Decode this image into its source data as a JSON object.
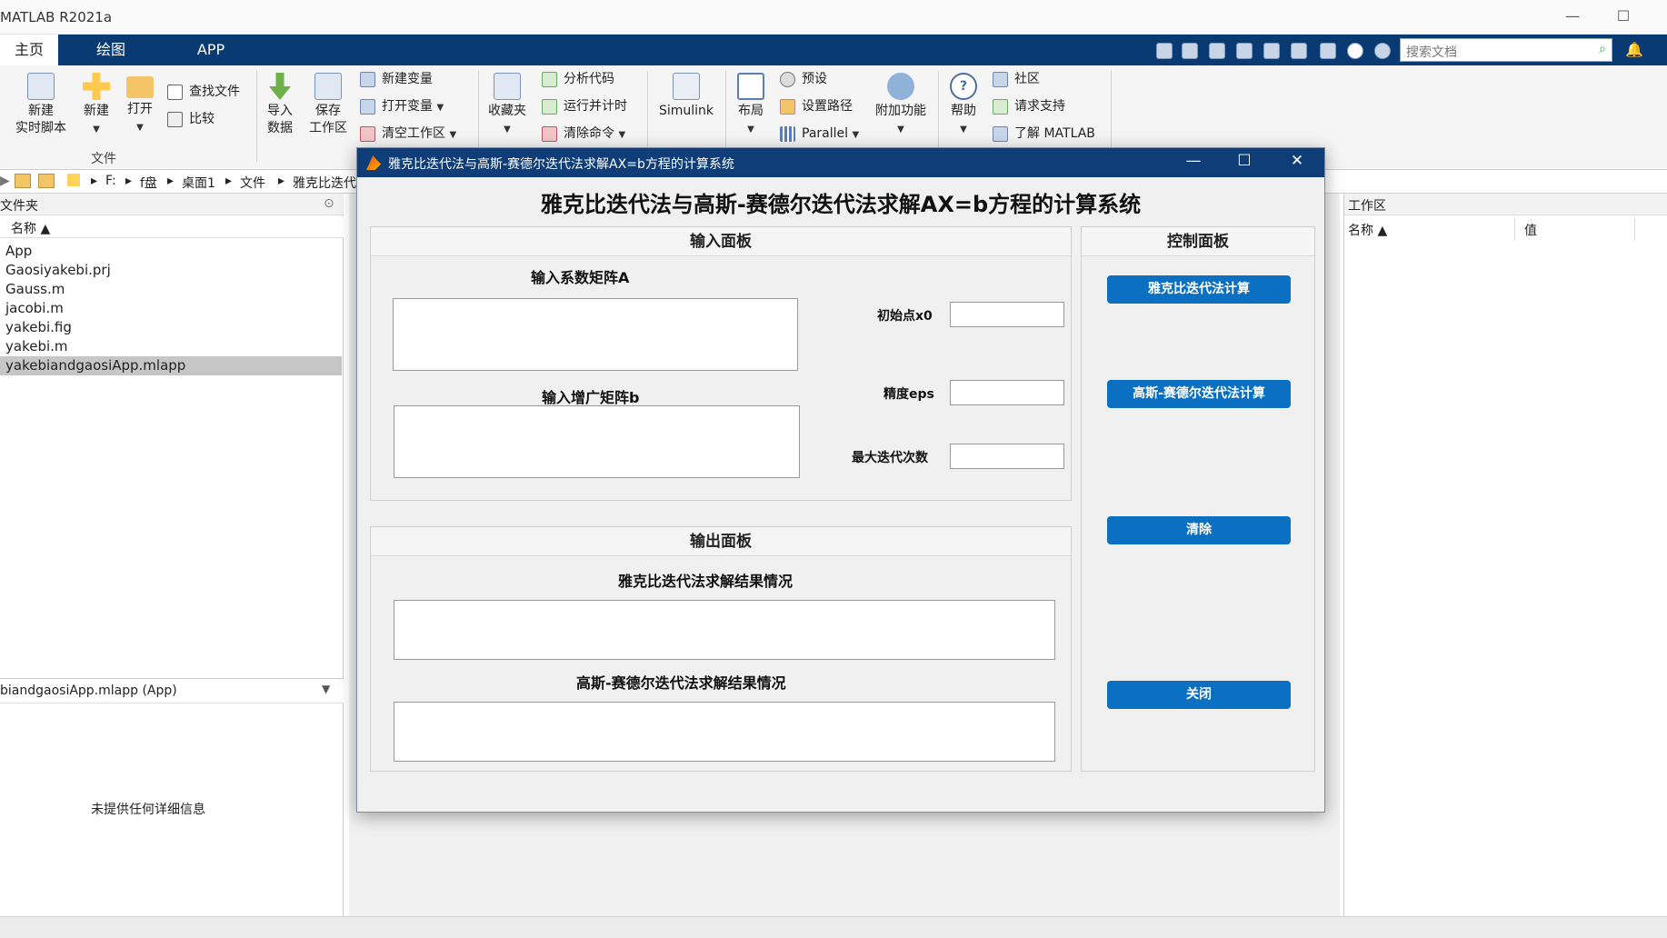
{
  "window": {
    "title": "MATLAB R2021a"
  },
  "ribbon_tabs": [
    "主页",
    "绘图",
    "APP"
  ],
  "search": {
    "placeholder": "搜索文档"
  },
  "ribbon": {
    "new_live_script": "新建\n实时脚本",
    "new": "新建",
    "open": "打开",
    "find_files": "查找文件",
    "compare": "比较",
    "file_group": "文件",
    "import_data": "导入\n数据",
    "save_workspace": "保存\n工作区",
    "new_variable": "新建变量",
    "open_variable": "打开变量",
    "clear_workspace": "清空工作区",
    "favorites": "收藏夹",
    "analyze_code": "分析代码",
    "run_and_time": "运行并计时",
    "clear_commands": "清除命令",
    "simulink": "Simulink",
    "layout": "布局",
    "preferences": "预设",
    "set_path": "设置路径",
    "parallel": "Parallel",
    "addons": "附加功能",
    "help": "帮助",
    "community": "社区",
    "request_support": "请求支持",
    "learn_matlab": "了解 MATLAB"
  },
  "address": [
    "F:",
    "f盘",
    "桌面1",
    "文件",
    "雅克比迭代"
  ],
  "files_panel": {
    "title": "文件夹",
    "column": "名称 ▲",
    "items": [
      "App",
      "Gaosiyakebi.prj",
      "Gauss.m",
      "jacobi.m",
      "yakebi.fig",
      "yakebi.m",
      "yakebiandgaosiApp.mlapp"
    ],
    "selected_index": 6,
    "details_header": "biandgaosiApp.mlapp  (App)",
    "details_text": "未提供任何详细信息"
  },
  "workspace": {
    "title": "工作区",
    "col_name": "名称 ▲",
    "col_value": "值"
  },
  "app": {
    "window_title": "雅克比迭代法与高斯-赛德尔迭代法求解AX=b方程的计算系统",
    "heading": "雅克比迭代法与高斯-赛德尔迭代法求解AX=b方程的计算系统",
    "input_panel": {
      "title": "输入面板",
      "matrix_a_label": "输入系数矩阵A",
      "matrix_b_label": "输入增广矩阵b",
      "x0_label": "初始点x0",
      "eps_label": "精度eps",
      "maxiter_label": "最大迭代次数"
    },
    "output_panel": {
      "title": "输出面板",
      "jacobi_label": "雅克比迭代法求解结果情况",
      "gs_label": "高斯-赛德尔迭代法求解结果情况"
    },
    "control_panel": {
      "title": "控制面板",
      "jacobi_button": "雅克比迭代法计算",
      "gs_button": "高斯-赛德尔迭代法计算",
      "clear_button": "清除",
      "close_button": "关闭"
    }
  }
}
